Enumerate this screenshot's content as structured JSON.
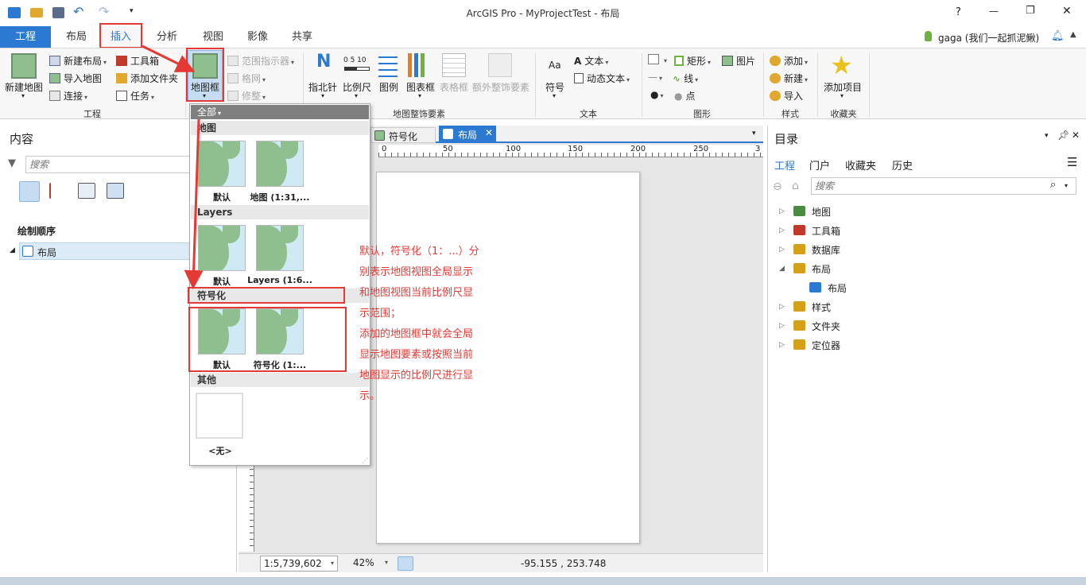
{
  "window": {
    "title": "ArcGIS Pro - MyProjectTest - 布局",
    "help": "?",
    "minimize": "—",
    "restore": "❐",
    "close": "✕"
  },
  "tabs": [
    {
      "label": "工程"
    },
    {
      "label": "布局"
    },
    {
      "label": "插入"
    },
    {
      "label": "分析"
    },
    {
      "label": "视图"
    },
    {
      "label": "影像"
    },
    {
      "label": "共享"
    }
  ],
  "user": {
    "name": "gaga (我们一起抓泥鳅)"
  },
  "ribbon": {
    "project": {
      "new_map": "新建地图",
      "new_layout": "新建布局",
      "import_map": "导入地图",
      "connect": "连接",
      "toolbox": "工具箱",
      "add_folder": "添加文件夹",
      "task": "任务",
      "group": "工程"
    },
    "map_frame": "地图框",
    "scale_indicator": "范围指示器",
    "grid": "格网",
    "trim": "修整",
    "surround": {
      "north_arrow": "指北针",
      "scale_bar": "比例尺",
      "legend": "图例",
      "chart_frame": "图表框",
      "table_frame": "表格框",
      "extra": "额外整饰要素",
      "group": "地图整饰要素",
      "scale_ticks": "0 5 10"
    },
    "text": {
      "symbol": "符号",
      "text": "文本",
      "dynamic_text": "动态文本",
      "group": "文本",
      "aa": "Aa"
    },
    "graphics": {
      "rectangle": "矩形",
      "line": "线",
      "point": "点",
      "picture": "图片",
      "group": "图形"
    },
    "styles": {
      "add": "添加",
      "new": "新建",
      "import": "导入",
      "group": "样式"
    },
    "favorites": {
      "add_item": "添加项目",
      "group": "收藏夹"
    }
  },
  "contents": {
    "title": "内容",
    "search_placeholder": "搜索",
    "drawing_order": "绘制顺序",
    "item": "布局"
  },
  "view_tabs": {
    "symbology": "符号化",
    "layout": "布局"
  },
  "ruler_ticks": [
    "0",
    "50",
    "100",
    "150",
    "200",
    "250",
    "3"
  ],
  "status": {
    "scale": "1:5,739,602",
    "zoom": "42%",
    "coords": "-95.155 , 253.748"
  },
  "gallery": {
    "filter": "全部",
    "sections": [
      {
        "title": "地图",
        "items": [
          "默认",
          "地图 (1:31,..."
        ]
      },
      {
        "title": "Layers",
        "items": [
          "默认",
          "Layers (1:6..."
        ]
      },
      {
        "title": "符号化",
        "items": [
          "默认",
          "符号化 (1:..."
        ]
      },
      {
        "title": "其他",
        "items": [
          "<无>"
        ]
      }
    ]
  },
  "annotation": "默认，符号化（1：...）分\n别表示地图视图全局显示\n和地图视图当前比例尺显\n示范围；\n添加的地图框中就会全局\n显示地图要素或按照当前\n地图显示的比例尺进行显\n示。",
  "catalog": {
    "title": "目录",
    "tabs": [
      "工程",
      "门户",
      "收藏夹",
      "历史"
    ],
    "search_placeholder": "搜索",
    "tree": [
      {
        "label": "地图",
        "color": "#4a8c3f"
      },
      {
        "label": "工具箱",
        "color": "#c0392b"
      },
      {
        "label": "数据库",
        "color": "#d4a017"
      },
      {
        "label": "布局",
        "color": "#d4a017"
      },
      {
        "label": "布局",
        "color": "#2b79d0"
      },
      {
        "label": "样式",
        "color": "#d4a017"
      },
      {
        "label": "文件夹",
        "color": "#d4a017"
      },
      {
        "label": "定位器",
        "color": "#d4a017"
      }
    ]
  },
  "colors": {
    "accent": "#2b79d0",
    "highlight": "#e53935"
  }
}
